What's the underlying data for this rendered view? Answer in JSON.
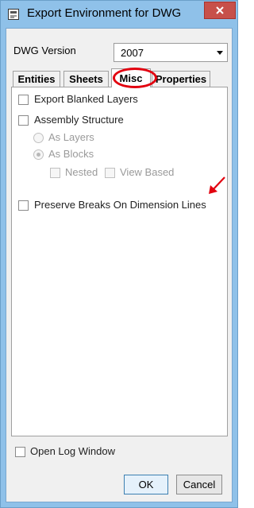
{
  "window": {
    "title": "Export Environment for DWG"
  },
  "dwg_version": {
    "label": "DWG Version",
    "selected": "2007"
  },
  "tabs": [
    {
      "label": "Entities"
    },
    {
      "label": "Sheets"
    },
    {
      "label": "Misc",
      "active": true
    },
    {
      "label": "Properties"
    }
  ],
  "misc": {
    "export_blanked_layers": "Export Blanked Layers",
    "assembly_structure": "Assembly Structure",
    "as_layers": "As Layers",
    "as_blocks": "As Blocks",
    "nested": "Nested",
    "view_based": "View Based",
    "preserve_breaks": "Preserve Breaks On Dimension Lines"
  },
  "open_log_window": "Open Log Window",
  "buttons": {
    "ok": "OK",
    "cancel": "Cancel"
  },
  "colors": {
    "annotation": "#e2000f",
    "window_frame": "#8fc1e9"
  },
  "icons": {
    "window_icon": "export-icon",
    "close": "close-icon",
    "annotation_arrow": "annotation-arrow"
  }
}
